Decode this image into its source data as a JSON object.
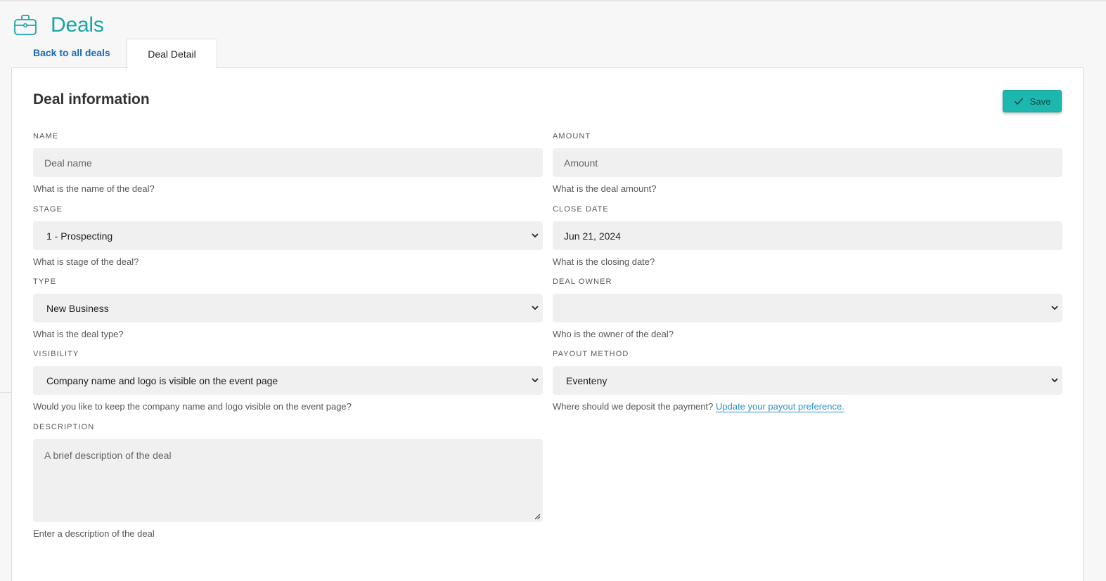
{
  "app": {
    "title": "Deals",
    "accent": "#1aa6a6",
    "icon": "briefcase-icon"
  },
  "tabs": {
    "back_label": "Back to all deals",
    "active_label": "Deal Detail"
  },
  "panel": {
    "title": "Deal information",
    "save_label": "Save"
  },
  "fields": {
    "name": {
      "label": "NAME",
      "placeholder": "Deal name",
      "help": "What is the name of the deal?"
    },
    "amount": {
      "label": "AMOUNT",
      "placeholder": "Amount",
      "help": "What is the deal amount?"
    },
    "stage": {
      "label": "STAGE",
      "value": "1 - Prospecting",
      "help": "What is stage of the deal?"
    },
    "close_date": {
      "label": "CLOSE DATE",
      "value": "Jun 21, 2024",
      "help": "What is the closing date?"
    },
    "type": {
      "label": "TYPE",
      "value": "New Business",
      "help": "What is the deal type?"
    },
    "deal_owner": {
      "label": "DEAL OWNER",
      "value": "",
      "help": "Who is the owner of the deal?"
    },
    "visibility": {
      "label": "VISIBILITY",
      "value": "Company name and logo is visible on the event page",
      "help": "Would you like to keep the company name and logo visible on the event page?"
    },
    "payout_method": {
      "label": "PAYOUT METHOD",
      "value": "Eventeny",
      "help": "Where should we deposit the payment?",
      "help_link": "Update your payout preference."
    },
    "description": {
      "label": "DESCRIPTION",
      "placeholder": "A brief description of the deal",
      "help": "Enter a description of the deal"
    }
  }
}
